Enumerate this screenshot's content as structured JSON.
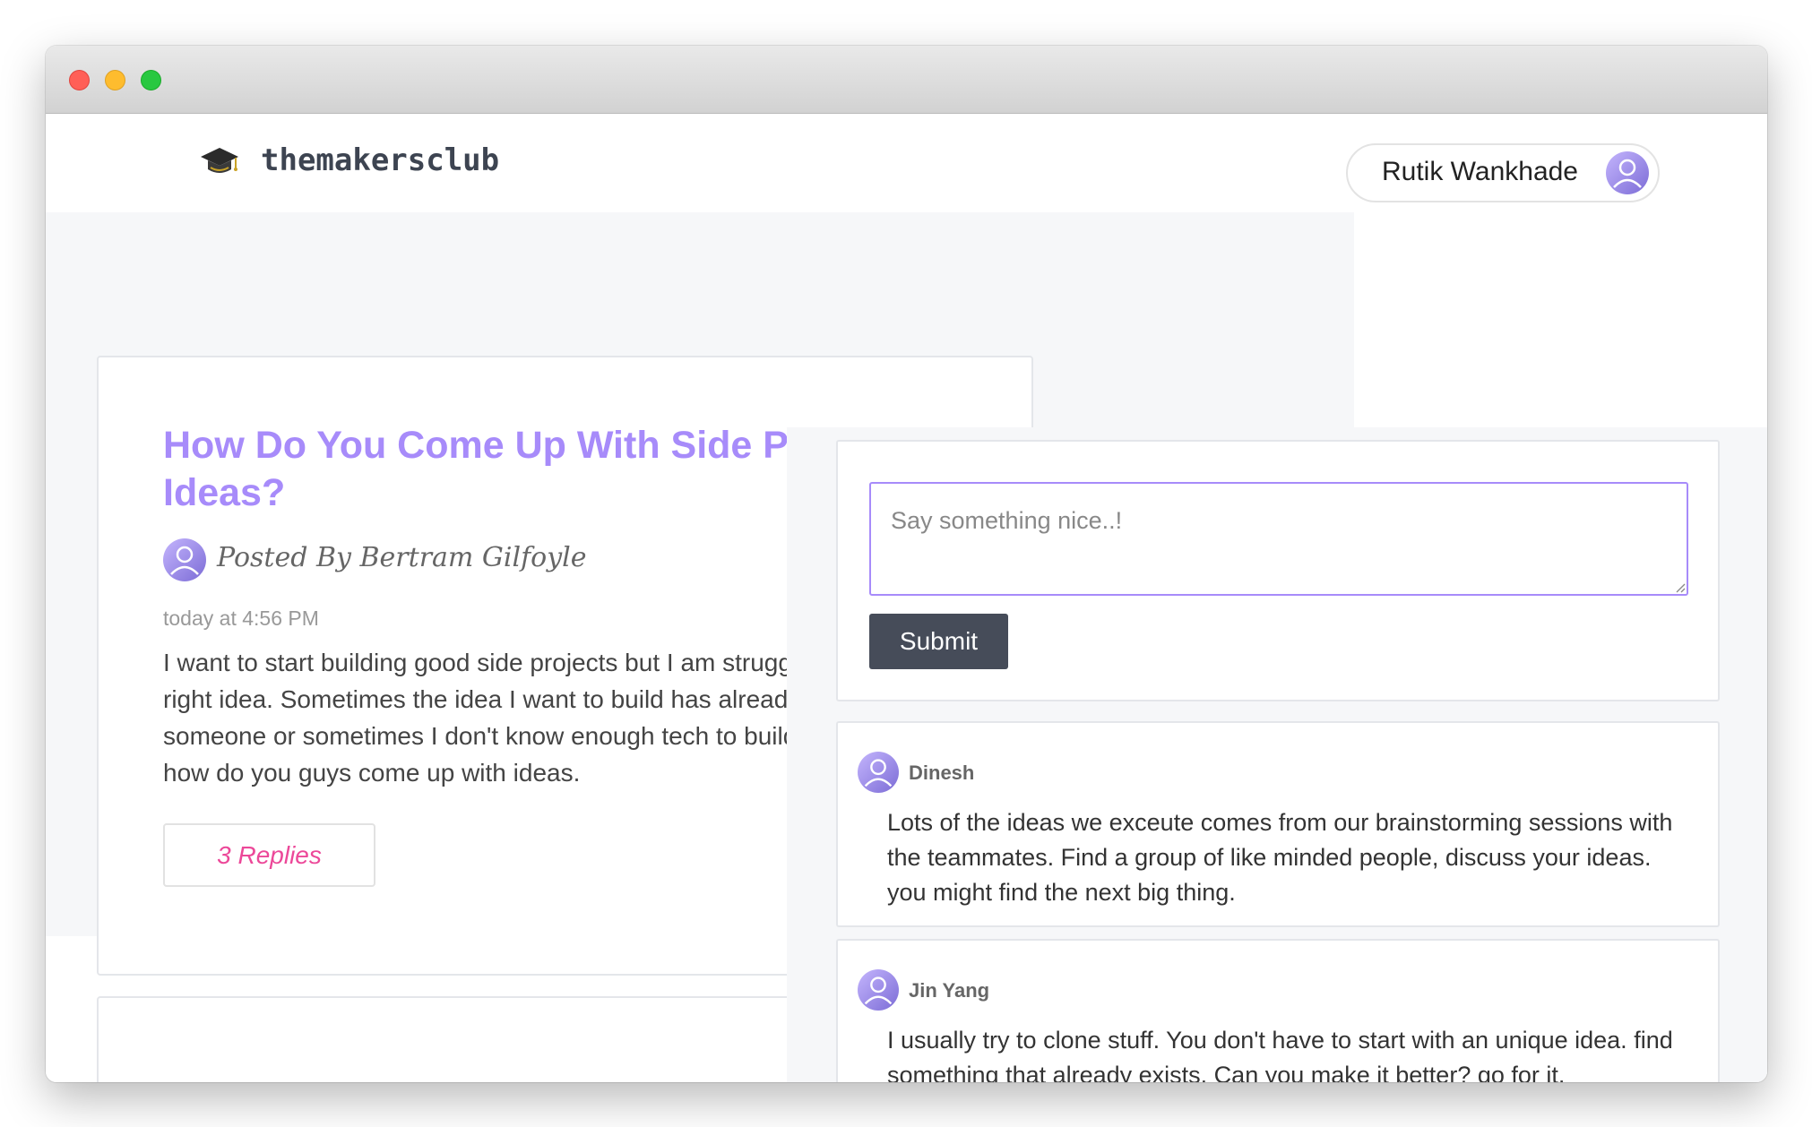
{
  "window": {
    "controls": [
      "close",
      "minimize",
      "zoom"
    ]
  },
  "header": {
    "brand": "themakersclub",
    "logo_icon": "graduation-cap-icon",
    "user_name": "Rutik Wankhade",
    "user_avatar_icon": "user-avatar-icon"
  },
  "post": {
    "title": "How Do You Come Up With Side Project Ideas?",
    "author": "Posted By Bertram Gilfoyle",
    "time": "today at 4:56 PM",
    "body": "I want to start building good side projects but I am struggling with picking the right idea. Sometimes the idea I want to build has already been executed by someone or sometimes I don't know enough tech to build the idea. I wonder how do you guys come up with ideas.",
    "replies_label": "3 Replies"
  },
  "comment_form": {
    "placeholder": "Say something nice..!",
    "value": "",
    "submit_label": "Submit"
  },
  "replies": [
    {
      "author": "Dinesh",
      "text": "Lots of the ideas we exceute comes from our brainstorming sessions with the teammates. Find a group of like minded people, discuss your ideas. you might find the next big thing."
    },
    {
      "author": "Jin Yang",
      "text": "I usually try to clone stuff. You don't have to start with an unique idea. find something that already exists. Can you make it better? go for it."
    }
  ],
  "colors": {
    "accent_purple": "#a78bfa",
    "replies_pink": "#ec4899",
    "submit_bg": "#464c59",
    "page_gray": "#f6f7f9"
  }
}
